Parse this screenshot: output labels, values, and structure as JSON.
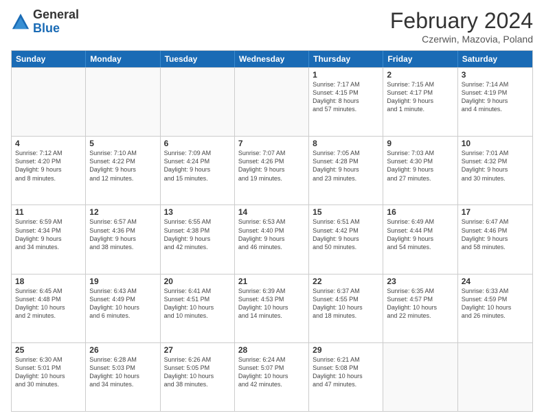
{
  "header": {
    "logo_general": "General",
    "logo_blue": "Blue",
    "month_title": "February 2024",
    "location": "Czerwin, Mazovia, Poland"
  },
  "days_of_week": [
    "Sunday",
    "Monday",
    "Tuesday",
    "Wednesday",
    "Thursday",
    "Friday",
    "Saturday"
  ],
  "weeks": [
    [
      {
        "day": "",
        "info": ""
      },
      {
        "day": "",
        "info": ""
      },
      {
        "day": "",
        "info": ""
      },
      {
        "day": "",
        "info": ""
      },
      {
        "day": "1",
        "info": "Sunrise: 7:17 AM\nSunset: 4:15 PM\nDaylight: 8 hours\nand 57 minutes."
      },
      {
        "day": "2",
        "info": "Sunrise: 7:15 AM\nSunset: 4:17 PM\nDaylight: 9 hours\nand 1 minute."
      },
      {
        "day": "3",
        "info": "Sunrise: 7:14 AM\nSunset: 4:19 PM\nDaylight: 9 hours\nand 4 minutes."
      }
    ],
    [
      {
        "day": "4",
        "info": "Sunrise: 7:12 AM\nSunset: 4:20 PM\nDaylight: 9 hours\nand 8 minutes."
      },
      {
        "day": "5",
        "info": "Sunrise: 7:10 AM\nSunset: 4:22 PM\nDaylight: 9 hours\nand 12 minutes."
      },
      {
        "day": "6",
        "info": "Sunrise: 7:09 AM\nSunset: 4:24 PM\nDaylight: 9 hours\nand 15 minutes."
      },
      {
        "day": "7",
        "info": "Sunrise: 7:07 AM\nSunset: 4:26 PM\nDaylight: 9 hours\nand 19 minutes."
      },
      {
        "day": "8",
        "info": "Sunrise: 7:05 AM\nSunset: 4:28 PM\nDaylight: 9 hours\nand 23 minutes."
      },
      {
        "day": "9",
        "info": "Sunrise: 7:03 AM\nSunset: 4:30 PM\nDaylight: 9 hours\nand 27 minutes."
      },
      {
        "day": "10",
        "info": "Sunrise: 7:01 AM\nSunset: 4:32 PM\nDaylight: 9 hours\nand 30 minutes."
      }
    ],
    [
      {
        "day": "11",
        "info": "Sunrise: 6:59 AM\nSunset: 4:34 PM\nDaylight: 9 hours\nand 34 minutes."
      },
      {
        "day": "12",
        "info": "Sunrise: 6:57 AM\nSunset: 4:36 PM\nDaylight: 9 hours\nand 38 minutes."
      },
      {
        "day": "13",
        "info": "Sunrise: 6:55 AM\nSunset: 4:38 PM\nDaylight: 9 hours\nand 42 minutes."
      },
      {
        "day": "14",
        "info": "Sunrise: 6:53 AM\nSunset: 4:40 PM\nDaylight: 9 hours\nand 46 minutes."
      },
      {
        "day": "15",
        "info": "Sunrise: 6:51 AM\nSunset: 4:42 PM\nDaylight: 9 hours\nand 50 minutes."
      },
      {
        "day": "16",
        "info": "Sunrise: 6:49 AM\nSunset: 4:44 PM\nDaylight: 9 hours\nand 54 minutes."
      },
      {
        "day": "17",
        "info": "Sunrise: 6:47 AM\nSunset: 4:46 PM\nDaylight: 9 hours\nand 58 minutes."
      }
    ],
    [
      {
        "day": "18",
        "info": "Sunrise: 6:45 AM\nSunset: 4:48 PM\nDaylight: 10 hours\nand 2 minutes."
      },
      {
        "day": "19",
        "info": "Sunrise: 6:43 AM\nSunset: 4:49 PM\nDaylight: 10 hours\nand 6 minutes."
      },
      {
        "day": "20",
        "info": "Sunrise: 6:41 AM\nSunset: 4:51 PM\nDaylight: 10 hours\nand 10 minutes."
      },
      {
        "day": "21",
        "info": "Sunrise: 6:39 AM\nSunset: 4:53 PM\nDaylight: 10 hours\nand 14 minutes."
      },
      {
        "day": "22",
        "info": "Sunrise: 6:37 AM\nSunset: 4:55 PM\nDaylight: 10 hours\nand 18 minutes."
      },
      {
        "day": "23",
        "info": "Sunrise: 6:35 AM\nSunset: 4:57 PM\nDaylight: 10 hours\nand 22 minutes."
      },
      {
        "day": "24",
        "info": "Sunrise: 6:33 AM\nSunset: 4:59 PM\nDaylight: 10 hours\nand 26 minutes."
      }
    ],
    [
      {
        "day": "25",
        "info": "Sunrise: 6:30 AM\nSunset: 5:01 PM\nDaylight: 10 hours\nand 30 minutes."
      },
      {
        "day": "26",
        "info": "Sunrise: 6:28 AM\nSunset: 5:03 PM\nDaylight: 10 hours\nand 34 minutes."
      },
      {
        "day": "27",
        "info": "Sunrise: 6:26 AM\nSunset: 5:05 PM\nDaylight: 10 hours\nand 38 minutes."
      },
      {
        "day": "28",
        "info": "Sunrise: 6:24 AM\nSunset: 5:07 PM\nDaylight: 10 hours\nand 42 minutes."
      },
      {
        "day": "29",
        "info": "Sunrise: 6:21 AM\nSunset: 5:08 PM\nDaylight: 10 hours\nand 47 minutes."
      },
      {
        "day": "",
        "info": ""
      },
      {
        "day": "",
        "info": ""
      }
    ]
  ]
}
